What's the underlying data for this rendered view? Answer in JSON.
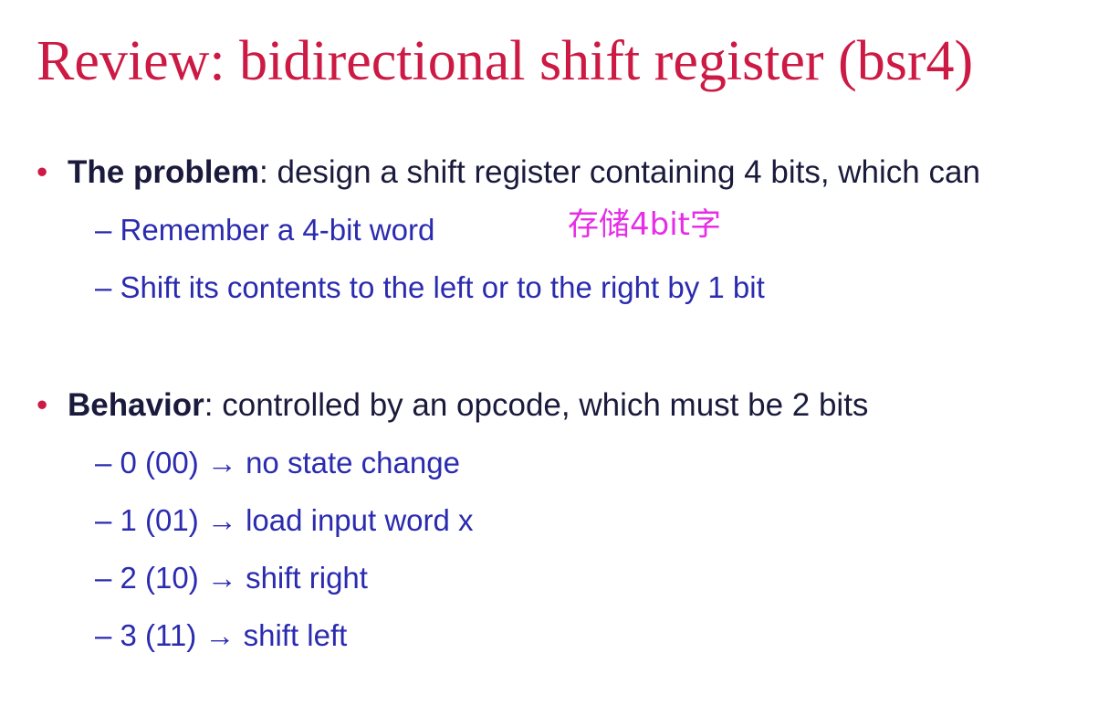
{
  "slide": {
    "title": "Review: bidirectional shift register (bsr4)"
  },
  "bullets": [
    {
      "marker": "•",
      "term": "The problem",
      "rest": ": design a shift register containing 4 bits, which can",
      "items": [
        "– Remember a 4-bit word",
        "– Shift its contents to the left or to the right by 1 bit"
      ]
    },
    {
      "marker": "•",
      "term": "Behavior",
      "rest": ": controlled by an opcode, which must be 2 bits",
      "items": [
        "– 0 (00) → no state change",
        "– 1 (01) → load input word x",
        "– 2 (10) → shift right",
        "– 3 (11) → shift left"
      ]
    }
  ],
  "annotation": {
    "text": "存储4bit字",
    "color": "#e62ee6"
  },
  "colors": {
    "title": "#cc1a44",
    "bullet_text": "#1a1a3c",
    "sub_item_text": "#2b2bb0"
  }
}
